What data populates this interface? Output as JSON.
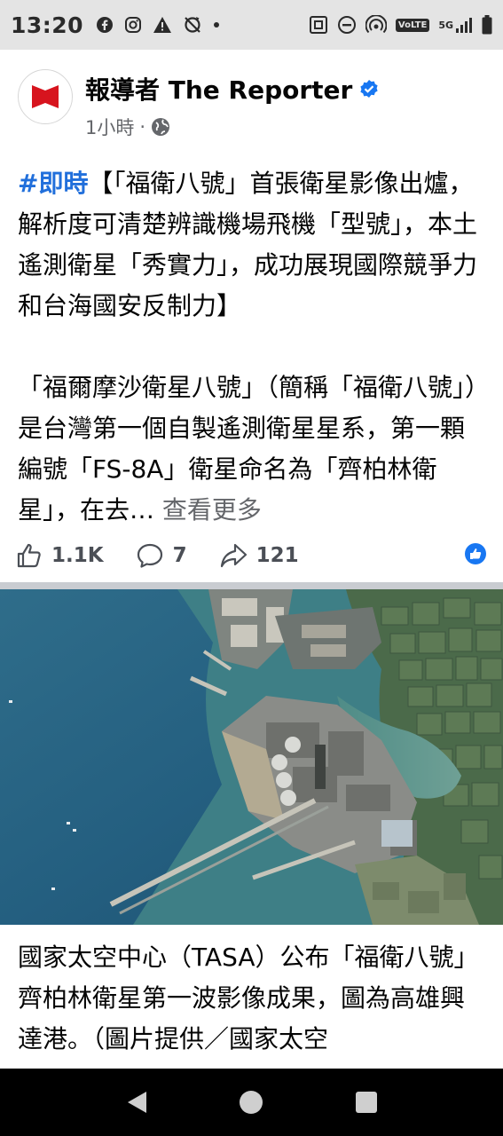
{
  "status_bar": {
    "time": "13:20",
    "network": "5G",
    "volte": "VoLTE"
  },
  "post": {
    "page_name": "報導者 The Reporter",
    "time_ago": "1小時",
    "separator": "·",
    "hashtag": "#即時",
    "headline": "【「福衛八號」首張衛星影像出爐，解析度可清楚辨識機場飛機「型號」，本土遙測衛星「秀實力」，成功展現國際競爭力和台海國安反制力】",
    "body": "「福爾摩沙衛星八號」（簡稱「福衛八號」）是台灣第一個自製遙測衛星星系，第一顆編號「FS-8A」衛星命名為「齊柏林衛星」，在去…",
    "see_more": "查看更多",
    "likes": "1.1K",
    "comments": "7",
    "shares": "121"
  },
  "photo": {
    "caption": "國家太空中心（TASA）公布「福衛八號」齊柏林衛星第一波影像成果，圖為高雄興達港。（圖片提供／國家太空"
  },
  "colors": {
    "accent_blue": "#216fdb",
    "like_blue": "#1877f2",
    "logo_red": "#d7141e"
  }
}
